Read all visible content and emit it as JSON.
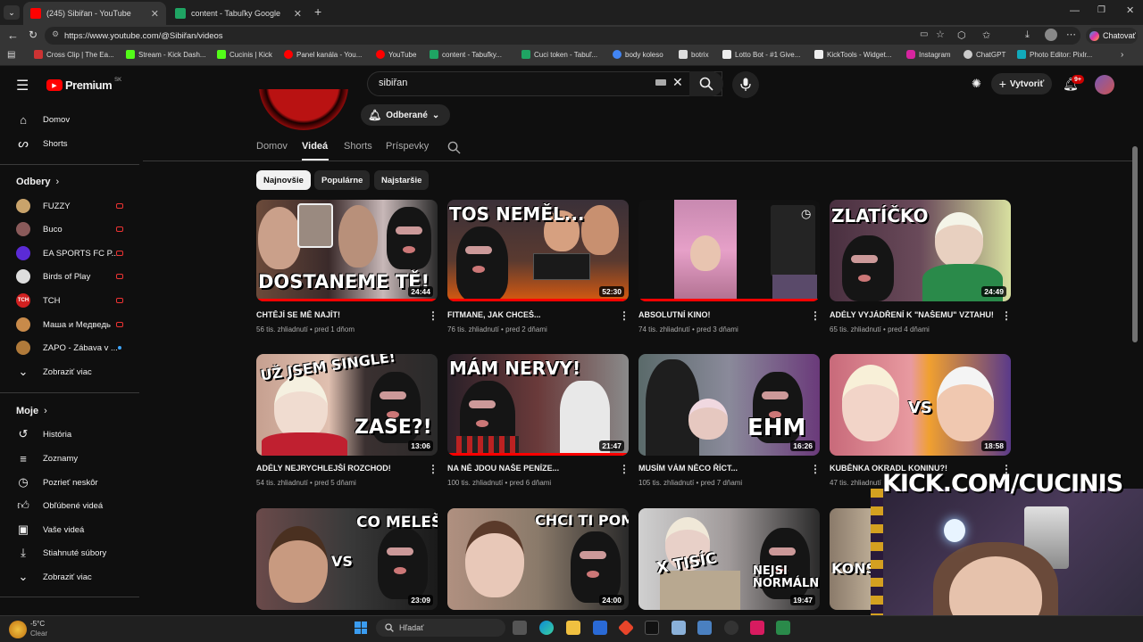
{
  "browser": {
    "tabs": [
      {
        "title": "(245) Sibiřan - YouTube",
        "active": true
      },
      {
        "title": "content - Tabuľky Google",
        "active": false
      }
    ],
    "url": "https://www.youtube.com/@Sibiřan/videos",
    "profile_button": "Chatovať",
    "bookmarks": [
      "Cross Clip | The Ea...",
      "Stream - Kick Dash...",
      "Cucinis | Kick",
      "Panel kanála - You...",
      "YouTube",
      "content - Tabuľky...",
      "Cuci token - Tabuľ...",
      "body koleso",
      "botrix",
      "Lotto Bot - #1 Give...",
      "KickTools - Widget...",
      "Instagram",
      "ChatGPT",
      "Photo Editor: Pixlr..."
    ]
  },
  "youtube": {
    "logo": "Premium",
    "logo_region": "SK",
    "search_value": "sibiřan",
    "create_label": "Vytvoriť",
    "notif_count": "9+",
    "subscribed_label": "Odberané",
    "channel_tabs": [
      "Domov",
      "Videá",
      "Shorts",
      "Príspevky"
    ],
    "chips": [
      "Najnovšie",
      "Populárne",
      "Najstaršie"
    ]
  },
  "sidebar": {
    "top": [
      {
        "label": "Domov",
        "icon": "home-icon"
      },
      {
        "label": "Shorts",
        "icon": "shorts-icon"
      }
    ],
    "subs_heading": "Odbery",
    "subs": [
      {
        "label": "FUZZY",
        "color": "#c9a36b"
      },
      {
        "label": "Buco",
        "color": "#8a5a5a"
      },
      {
        "label": "EA SPORTS FC P...",
        "color": "#5b2bd6"
      },
      {
        "label": "Birds of Play",
        "color": "#dddddd"
      },
      {
        "label": "TCH",
        "color": "#d02020"
      },
      {
        "label": "Маша и Медведь",
        "color": "#c88a4a"
      },
      {
        "label": "ZAPO - Zábava v ...",
        "color": "#b07a3a"
      }
    ],
    "subs_more": "Zobraziť viac",
    "you_heading": "Moje",
    "you": [
      {
        "label": "História",
        "icon": "history-icon"
      },
      {
        "label": "Zoznamy",
        "icon": "playlists-icon"
      },
      {
        "label": "Pozrieť neskôr",
        "icon": "watch-later-icon"
      },
      {
        "label": "Obľúbené videá",
        "icon": "liked-icon"
      },
      {
        "label": "Vaše videá",
        "icon": "your-videos-icon"
      },
      {
        "label": "Stiahnuté súbory",
        "icon": "downloads-icon"
      }
    ],
    "you_more": "Zobraziť viac"
  },
  "videos": [
    {
      "title": "CHTĚJÍ SE MĚ NAJÍT!",
      "views": "56 tis. zhliadnutí",
      "age": "pred 1 dňom",
      "duration": "24:44",
      "thumb_text": "DOSTANEME TĚ!"
    },
    {
      "title": "FITMANE, JAK CHCEŠ...",
      "views": "76 tis. zhliadnutí",
      "age": "pred 2 dňami",
      "duration": "52:30",
      "thumb_text": "TOS NEMĚL..."
    },
    {
      "title": "ABSOLUTNÍ KINO!",
      "views": "74 tis. zhliadnutí",
      "age": "pred 3 dňami",
      "duration": "",
      "thumb_text": ""
    },
    {
      "title": "ADÉLY VYJÁDŘENÍ K \"NAŠEMU\" VZTAHU!",
      "views": "65 tis. zhliadnutí",
      "age": "pred 4 dňami",
      "duration": "24:49",
      "thumb_text": "ZLATÍČKO"
    },
    {
      "title": "ADÉLY NEJRYCHLEJŠÍ ROZCHOD!",
      "views": "54 tis. zhliadnutí",
      "age": "pred 5 dňami",
      "duration": "13:06",
      "thumb_text": "ZASE?!"
    },
    {
      "title": "NA NĚ JDOU NAŠE PENÍZE...",
      "views": "100 tis. zhliadnutí",
      "age": "pred 6 dňami",
      "duration": "21:47",
      "thumb_text": "MÁM NERVY!"
    },
    {
      "title": "MUSÍM VÁM NĚCO ŘÍCT...",
      "views": "105 tis. zhliadnutí",
      "age": "pred 7 dňami",
      "duration": "16:26",
      "thumb_text": "EHM"
    },
    {
      "title": "KUBĚNKA OKRADL KONINU?!",
      "views": "47 tis. zhliadnutí",
      "age": "",
      "duration": "18:58",
      "thumb_text": "VS"
    },
    {
      "title": "",
      "views": "",
      "age": "",
      "duration": "23:09",
      "thumb_text": "CO MELEŠ?!"
    },
    {
      "title": "",
      "views": "",
      "age": "",
      "duration": "24:00",
      "thumb_text": "CHCI TI POMOC."
    },
    {
      "title": "",
      "views": "",
      "age": "",
      "duration": "19:47",
      "thumb_text": "NEJSI NORMÁLNÍ!"
    },
    {
      "title": "",
      "views": "",
      "age": "",
      "duration": "",
      "thumb_text": "KONS"
    }
  ],
  "overlay": {
    "banner": "KICK.COM/CUCINIS"
  },
  "taskbar": {
    "weather_temp": "-5°C",
    "weather_desc": "Clear",
    "search_placeholder": "Hľadať"
  }
}
